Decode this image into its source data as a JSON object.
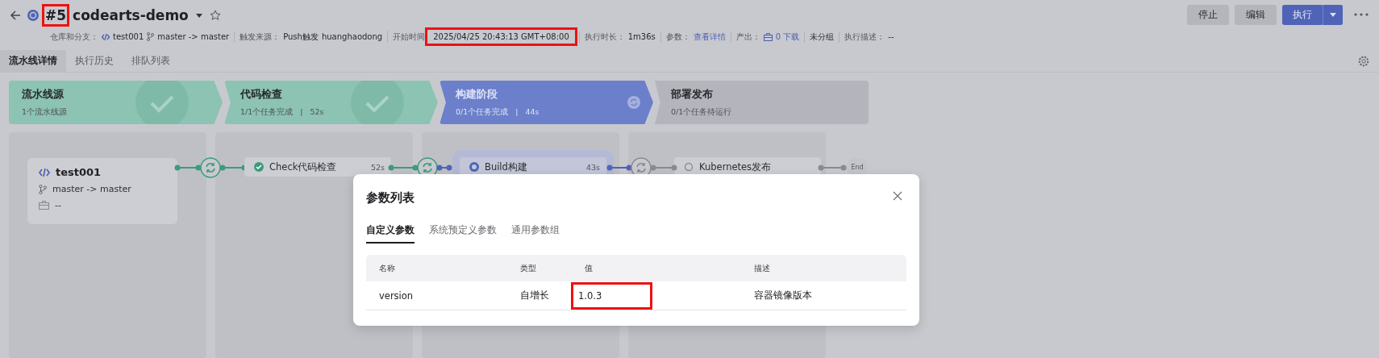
{
  "header": {
    "run_number": {
      "text": "#5",
      "highlighted": true
    },
    "title": "codearts-demo",
    "starred": false
  },
  "meta": [
    {
      "kind": "repo",
      "label": "仓库和分支：",
      "values": [
        "test001",
        "master -> master"
      ]
    },
    {
      "kind": "text",
      "label": "触发来源：",
      "values": [
        "Push触发",
        "huanghaodong"
      ]
    },
    {
      "kind": "text",
      "label": "开始时间",
      "values": [
        "2025/04/25 20:43:13 GMT+08:00"
      ],
      "highlighted": true
    },
    {
      "kind": "text",
      "label": "执行时长：",
      "values": [
        "1m36s"
      ]
    },
    {
      "kind": "link",
      "label": "参数：",
      "values": [
        "查看详情"
      ]
    },
    {
      "kind": "download",
      "label": "产出：",
      "values": [
        "0 下载"
      ]
    },
    {
      "kind": "plain",
      "values": [
        "未分组"
      ]
    },
    {
      "kind": "text",
      "label": "执行描述：",
      "values": [
        "--"
      ]
    }
  ],
  "buttons": [
    {
      "label": "停止",
      "kind": "secondary"
    },
    {
      "label": "编辑",
      "kind": "secondary"
    },
    {
      "label": "执行",
      "kind": "primary"
    }
  ],
  "tabs": [
    {
      "label": "流水线详情",
      "selected": true
    },
    {
      "label": "执行历史",
      "selected": false
    },
    {
      "label": "排队列表",
      "selected": false
    }
  ],
  "stages": [
    {
      "title": "流水线源",
      "subtitle": "1个流水线源",
      "kind": "success"
    },
    {
      "title": "代码检查",
      "subtitle": "1/1个任务完成",
      "separator": "|",
      "duration": "52s",
      "kind": "success"
    },
    {
      "title": "构建阶段",
      "subtitle": "0/1个任务完成",
      "separator": "|",
      "duration": "44s",
      "kind": "running"
    },
    {
      "title": "部署发布",
      "subtitle": "0/1个任务待运行",
      "kind": "pending"
    }
  ],
  "source": {
    "name": "test001",
    "branch": "master -> master",
    "artifact": "--"
  },
  "jobs": [
    {
      "name": "Check代码检查",
      "duration": "52s",
      "kind": "success"
    },
    {
      "name": "Build构建",
      "duration": "43s",
      "kind": "running"
    },
    {
      "name": "Kubernetes发布",
      "kind": "pending"
    }
  ],
  "end_label": "End",
  "dialog": {
    "title": "参数列表",
    "tabs": [
      {
        "label": "自定义参数",
        "selected": true
      },
      {
        "label": "系统预定义参数",
        "selected": false
      },
      {
        "label": "通用参数组",
        "selected": false
      }
    ],
    "columns": [
      "名称",
      "类型",
      "值",
      "描述"
    ],
    "rows": [
      {
        "name": "version",
        "type": "自增长",
        "value": "1.0.3",
        "description": "容器镜像版本",
        "value_highlighted": true
      }
    ]
  }
}
